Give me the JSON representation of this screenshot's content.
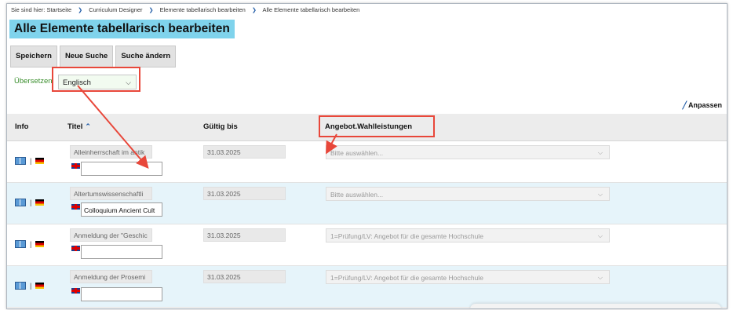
{
  "breadcrumb": {
    "prefix": "Sie sind hier:",
    "items": [
      "Startseite",
      "Curriculum Designer",
      "Elemente tabellarisch bearbeiten",
      "Alle Elemente tabellarisch bearbeiten"
    ]
  },
  "page_title": "Alle Elemente tabellarisch bearbeiten",
  "toolbar": {
    "save": "Speichern",
    "new_search": "Neue Suche",
    "change_search": "Suche ändern"
  },
  "translate": {
    "label": "Übersetzen",
    "selected": "Englisch"
  },
  "adjust_label": "Anpassen",
  "columns": {
    "info": "Info",
    "title": "Titel",
    "valid_until": "Gültig bis",
    "offer": "Angebot.Wahlleistungen"
  },
  "rows": [
    {
      "title": "Alleinherrschaft im antik",
      "english": "",
      "valid_until": "31.03.2025",
      "offer": "Bitte auswählen..."
    },
    {
      "title": "Altertumswissenschaftli",
      "english": "Colloquium Ancient Cult",
      "valid_until": "31.03.2025",
      "offer": "Bitte auswählen..."
    },
    {
      "title": "Anmeldung der \"Geschic",
      "english": "",
      "valid_until": "31.03.2025",
      "offer": "1=Prüfung/LV: Angebot für die gesamte Hochschule"
    },
    {
      "title": "Anmeldung der Prosemi",
      "english": "",
      "valid_until": "31.03.2025",
      "offer": "1=Prüfung/LV: Angebot für die gesamte Hochschule"
    }
  ],
  "colors": {
    "title_bg": "#7fd3ec",
    "accent_red": "#e8473a",
    "row_alt": "#e6f4fa",
    "link_blue": "#1e5aa6"
  },
  "icons": [
    "book-icon",
    "german-flag-icon",
    "uk-flag-icon",
    "pencil-icon",
    "sort-up-icon",
    "chevron-down-icon"
  ]
}
